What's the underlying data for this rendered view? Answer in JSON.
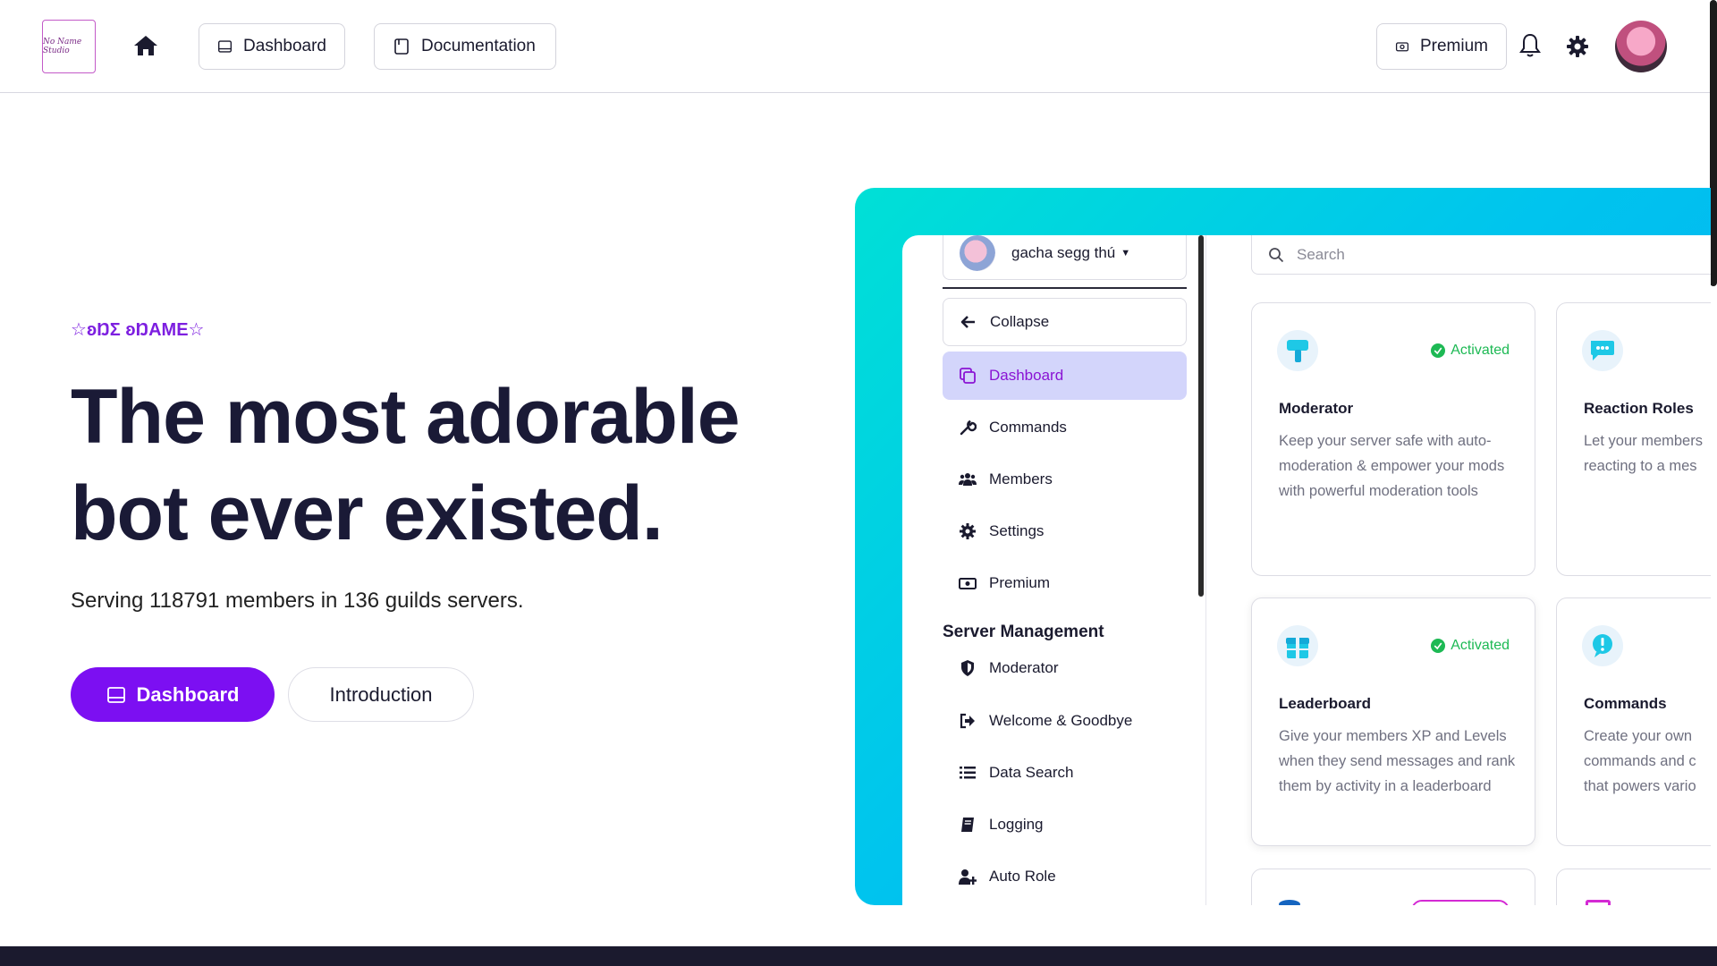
{
  "nav": {
    "logo_text": "No Name Studio",
    "dashboard_label": "Dashboard",
    "documentation_label": "Documentation",
    "premium_label": "Premium"
  },
  "hero": {
    "tagline": "☆ʚŊΣ ʚŊAME☆",
    "title_line1": "The most adorable",
    "title_line2": "bot ever existed.",
    "subtitle": "Serving 118791 members in 136 guilds servers.",
    "primary_cta": "Dashboard",
    "secondary_cta": "Introduction"
  },
  "preview": {
    "guild_name": "gacha segg thú",
    "search_placeholder": "Search",
    "sidebar": {
      "items": [
        {
          "label": "Collapse"
        },
        {
          "label": "Dashboard"
        },
        {
          "label": "Commands"
        },
        {
          "label": "Members"
        },
        {
          "label": "Settings"
        },
        {
          "label": "Premium"
        }
      ],
      "section_heading": "Server Management",
      "section_items": [
        {
          "label": "Moderator"
        },
        {
          "label": "Welcome & Goodbye"
        },
        {
          "label": "Data Search"
        },
        {
          "label": "Logging"
        },
        {
          "label": "Auto Role"
        }
      ]
    },
    "cards": [
      {
        "title": "Moderator",
        "badge": "Activated",
        "desc": "Keep your server safe with auto-moderation & empower your mods with powerful moderation tools"
      },
      {
        "title": "Reaction Roles",
        "desc_lines": [
          "Let your members",
          "reacting to a mes"
        ]
      },
      {
        "title": "Leaderboard",
        "badge": "Activated",
        "desc": "Give your members XP and Levels when they send messages and rank them by activity in a leaderboard"
      },
      {
        "title": "Commands",
        "desc_lines": [
          "Create your own",
          "commands and c",
          "that powers vario"
        ]
      }
    ]
  },
  "colors": {
    "accent": "#7c0ff2",
    "active_bg": "#d3d5fb",
    "badge_green": "#1db954",
    "gradient_start": "#00e0d6",
    "gradient_end": "#07a8f5"
  }
}
